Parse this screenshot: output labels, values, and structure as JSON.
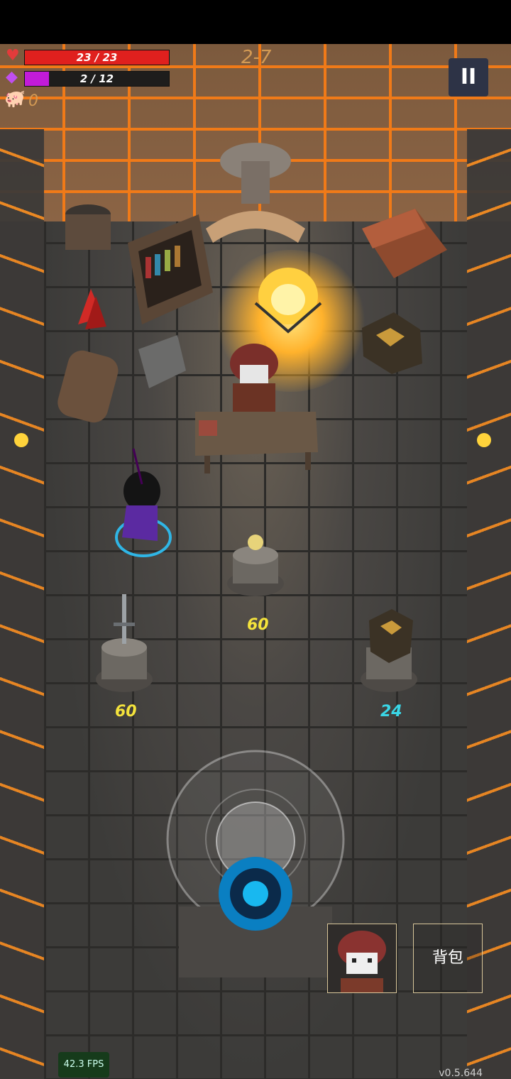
{
  "hud": {
    "health": {
      "current": 23,
      "max": 23,
      "text": "23 / 23",
      "color": "#e0201e",
      "fraction": 1.0
    },
    "mana": {
      "current": 2,
      "max": 12,
      "text": "2 / 12",
      "color": "#c21bd8",
      "fraction": 0.1667
    },
    "coins": "0",
    "level": "2-7",
    "pause_label": "II"
  },
  "shop": {
    "prices": [
      {
        "item": "ring",
        "price": "60",
        "color": "#f4e33c"
      },
      {
        "item": "sword",
        "price": "60",
        "color": "#f4e33c"
      },
      {
        "item": "chest-box",
        "price": "24",
        "color": "#3ad6e6"
      }
    ]
  },
  "controls": {
    "bag_label": "背包",
    "portrait": "merchant-portrait"
  },
  "debug": {
    "fps": "42.3 FPS",
    "version": "v0.5.644"
  },
  "icons": [
    "heart-icon",
    "mana-gem-icon",
    "piggy-bank-icon",
    "pause-icon"
  ]
}
